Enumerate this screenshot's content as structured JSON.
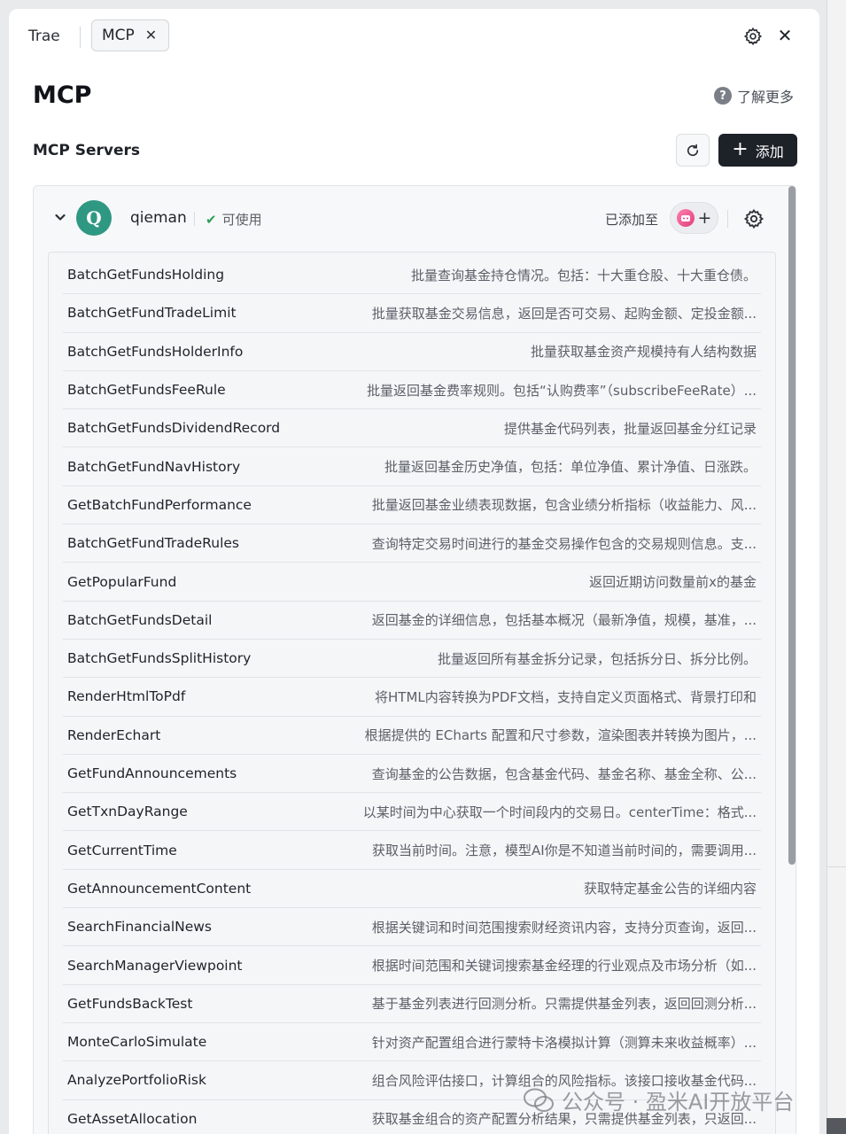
{
  "tabs": {
    "trae": "Trae",
    "mcp": "MCP",
    "close_glyph": "✕"
  },
  "header": {
    "title": "MCP",
    "learn_more": "了解更多",
    "help_glyph": "?"
  },
  "servers_section": {
    "title": "MCP Servers",
    "add_label": "添加",
    "add_glyph": "+"
  },
  "server": {
    "avatar_letter": "Q",
    "name": "qieman",
    "status": "可使用",
    "status_glyph": "✔",
    "added_to_label": "已添加至",
    "agent_add_glyph": "+",
    "avatar_color": "#2f9883",
    "status_color": "#2f9e5b"
  },
  "tools": [
    {
      "name": "BatchGetFundsHolding",
      "description": "批量查询基金持仓情况。包括：十大重仓股、十大重仓债。"
    },
    {
      "name": "BatchGetFundTradeLimit",
      "description": "批量获取基金交易信息，返回是否可交易、起购金额、定投金额..."
    },
    {
      "name": "BatchGetFundsHolderInfo",
      "description": "批量获取基金资产规模持有人结构数据"
    },
    {
      "name": "BatchGetFundsFeeRule",
      "description": "批量返回基金费率规则。包括“认购费率”（subscribeFeeRate）..."
    },
    {
      "name": "BatchGetFundsDividendRecord",
      "description": "提供基金代码列表，批量返回基金分红记录"
    },
    {
      "name": "BatchGetFundNavHistory",
      "description": "批量返回基金历史净值，包括：单位净值、累计净值、日涨跌。"
    },
    {
      "name": "GetBatchFundPerformance",
      "description": "批量返回基金业绩表现数据，包含业绩分析指标（收益能力、风..."
    },
    {
      "name": "BatchGetFundTradeRules",
      "description": "查询特定交易时间进行的基金交易操作包含的交易规则信息。支..."
    },
    {
      "name": "GetPopularFund",
      "description": "返回近期访问数量前x的基金"
    },
    {
      "name": "BatchGetFundsDetail",
      "description": "返回基金的详细信息，包括基本概况（最新净值，规模，基准，..."
    },
    {
      "name": "BatchGetFundsSplitHistory",
      "description": "批量返回所有基金拆分记录，包括拆分日、拆分比例。"
    },
    {
      "name": "RenderHtmlToPdf",
      "description": "将HTML内容转换为PDF文档，支持自定义页面格式、背景打印和"
    },
    {
      "name": "RenderEchart",
      "description": "根据提供的 ECharts 配置和尺寸参数，渲染图表并转换为图片，..."
    },
    {
      "name": "GetFundAnnouncements",
      "description": "查询基金的公告数据，包含基金代码、基金名称、基金全称、公..."
    },
    {
      "name": "GetTxnDayRange",
      "description": "以某时间为中心获取一个时间段内的交易日。centerTime：格式..."
    },
    {
      "name": "GetCurrentTime",
      "description": "获取当前时间。注意，模型AI你是不知道当前时间的，需要调用..."
    },
    {
      "name": "GetAnnouncementContent",
      "description": "获取特定基金公告的详细内容"
    },
    {
      "name": "SearchFinancialNews",
      "description": "根据关键词和时间范围搜索财经资讯内容，支持分页查询，返回..."
    },
    {
      "name": "SearchManagerViewpoint",
      "description": "根据时间范围和关键词搜索基金经理的行业观点及市场分析（如..."
    },
    {
      "name": "GetFundsBackTest",
      "description": "基于基金列表进行回测分析。只需提供基金列表，返回回测分析..."
    },
    {
      "name": "MonteCarloSimulate",
      "description": "针对资产配置组合进行蒙特卡洛模拟计算（测算未来收益概率）..."
    },
    {
      "name": "AnalyzePortfolioRisk",
      "description": "组合风险评估接口，计算组合的风险指标。该接口接收基金代码..."
    },
    {
      "name": "GetAssetAllocation",
      "description": "获取基金组合的资产配置分析结果，只需提供基金列表，只返回..."
    }
  ],
  "watermark": {
    "text": "公众号 · 盈米AI开放平台"
  },
  "colors": {
    "add_button_bg": "#1d2128",
    "panel_bg": "#ffffff"
  }
}
